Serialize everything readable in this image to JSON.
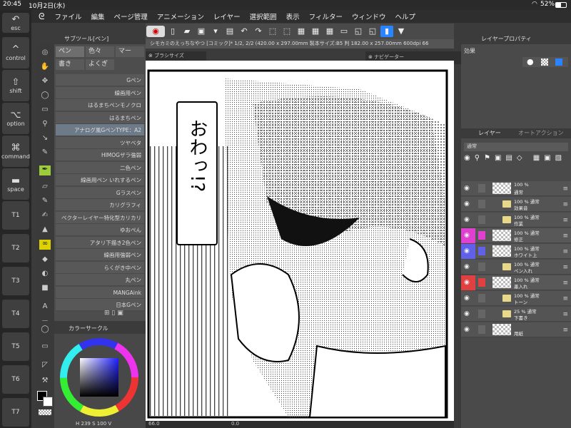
{
  "status": {
    "time": "20:45",
    "date": "10月2日(水)",
    "battery": "52%"
  },
  "menu": [
    "ファイル",
    "編集",
    "ページ管理",
    "アニメーション",
    "レイヤー",
    "選択範囲",
    "表示",
    "フィルター",
    "ウィンドウ",
    "ヘルプ"
  ],
  "left_buttons": [
    {
      "glyph": "↶",
      "label": "esc"
    },
    {
      "glyph": "^",
      "label": "control"
    },
    {
      "glyph": "⇧",
      "label": "shift"
    },
    {
      "glyph": "⌥",
      "label": "option"
    },
    {
      "glyph": "⌘",
      "label": "command"
    },
    {
      "glyph": "▬",
      "label": "space"
    },
    {
      "glyph": "",
      "label": "T1"
    },
    {
      "glyph": "",
      "label": "T2"
    },
    {
      "glyph": "",
      "label": "T3"
    },
    {
      "glyph": "",
      "label": "T4"
    },
    {
      "glyph": "",
      "label": "T5"
    },
    {
      "glyph": "",
      "label": "T6"
    },
    {
      "glyph": "",
      "label": "T7"
    }
  ],
  "document": {
    "title": "シモカミのえっちなやつ [コミック]* 1/2, 2/2 (420.00 x 297.00mm 製本サイズ:B5 判 182.00 x 257.00mm 600dpi 66"
  },
  "subtool": {
    "header": "サブツール[ペン]",
    "tabs": [
      "ペン",
      "色々",
      "マー",
      "書き",
      "よくぎ"
    ],
    "brushes": [
      "Gペン",
      "線画用ペン",
      "はるまちペンモノクロ",
      "はるまちペン",
      "アナログ風GペンTYPE：A2",
      "ツヤベタ",
      "HIMOGザラ強弱",
      "二色ペン",
      "線画用ペン いれするペン",
      "Gラスペン",
      "カリグラフィ",
      "ベクターレイヤー特化型カリカリ",
      "ゆおぺん",
      "アタリ下描き2色ペン",
      "線画用強弱ペン",
      "らくがき中ペン",
      "丸ペン",
      "MANGAink",
      "日本Gペン"
    ],
    "selected_index": 4
  },
  "color_panel": {
    "header": "カラーサークル",
    "values": [
      "H",
      "239",
      "S",
      "100",
      "V"
    ]
  },
  "panels": {
    "brush_size": "ブラシサイズ",
    "navigator": "ナビゲーター",
    "layer_property": "レイヤープロパティ",
    "effect_label": "効果",
    "layer_tab": "レイヤー",
    "auto_action_tab": "オートアクション",
    "blend_label": "通常"
  },
  "canvas": {
    "speech": "おわっ!?"
  },
  "layers": [
    {
      "name": "通常",
      "opacity": "100 %",
      "color": "",
      "folder": false
    },
    {
      "name": "効果音",
      "opacity": "100 % 通常",
      "color": "",
      "folder": true
    },
    {
      "name": "作業",
      "opacity": "100 % 通常",
      "color": "",
      "folder": true
    },
    {
      "name": "修正",
      "opacity": "100 % 通常",
      "color": "#e040d0",
      "folder": false
    },
    {
      "name": "ホワイト上",
      "opacity": "100 % 通常",
      "color": "#6060e8",
      "folder": false
    },
    {
      "name": "ペン入れ",
      "opacity": "100 % 通常",
      "color": "",
      "folder": true
    },
    {
      "name": "墨入れ",
      "opacity": "100 % 通常",
      "color": "#e04040",
      "folder": false
    },
    {
      "name": "トーン",
      "opacity": "100 % 通常",
      "color": "",
      "folder": true
    },
    {
      "name": "下書き",
      "opacity": "25 % 通常",
      "color": "",
      "folder": true
    },
    {
      "name": "用紙",
      "opacity": "",
      "color": "",
      "folder": false
    }
  ],
  "bottom": {
    "zoom": "66.0",
    "angle": "0.0"
  },
  "accent": "#2b84ff"
}
